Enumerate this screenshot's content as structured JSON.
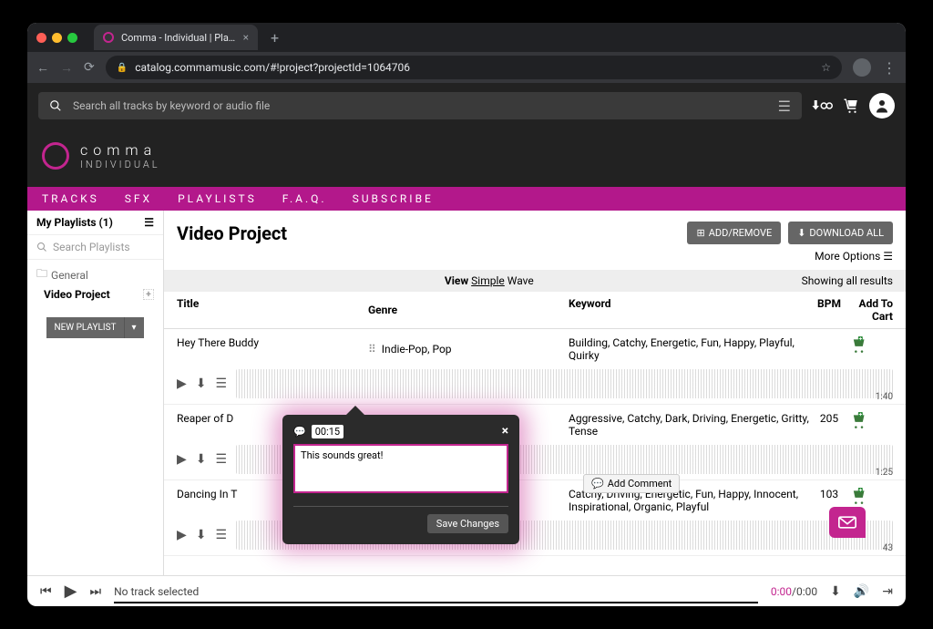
{
  "browser": {
    "tab_title": "Comma - Individual | Playlist D",
    "url": "catalog.commamusic.com/#!project?projectId=1064706"
  },
  "app_header": {
    "search_placeholder": "Search all tracks by keyword or audio file",
    "brand_line1": "comma",
    "brand_line2": "INDIVIDUAL"
  },
  "nav": {
    "items": [
      "TRACKS",
      "SFX",
      "PLAYLISTS",
      "F.A.Q.",
      "SUBSCRIBE"
    ]
  },
  "sidebar": {
    "title": "My Playlists (1)",
    "search_placeholder": "Search Playlists",
    "folder_label": "General",
    "playlist_item": "Video Project",
    "new_button": "NEW PLAYLIST"
  },
  "project": {
    "title": "Video Project",
    "add_remove": "ADD/REMOVE",
    "download_all": "DOWNLOAD ALL",
    "more_options": "More Options",
    "view_label": "View",
    "view_simple": "Simple",
    "view_wave": "Wave",
    "showing": "Showing all results"
  },
  "columns": {
    "title": "Title",
    "genre": "Genre",
    "keyword": "Keyword",
    "bpm": "BPM",
    "cart": "Add To Cart"
  },
  "tracks": [
    {
      "title": "Hey There Buddy",
      "genre": "Indie-Pop, Pop",
      "keyword": "Building, Catchy, Energetic, Fun, Happy, Playful, Quirky",
      "bpm": "",
      "duration": "1:40"
    },
    {
      "title": "Reaper of D",
      "genre": "",
      "keyword": "Aggressive, Catchy, Dark, Driving, Energetic, Gritty, Tense",
      "bpm": "205",
      "duration": "1:25"
    },
    {
      "title": "Dancing In T",
      "genre": "",
      "keyword": "Catchy, Driving, Energetic, Fun, Happy, Innocent, Inspirational, Organic, Playful",
      "bpm": "103",
      "duration": "43"
    }
  ],
  "popover": {
    "timestamp": "00:15",
    "text": "This sounds great!",
    "save": "Save Changes"
  },
  "add_comment_label": "Add Comment",
  "player": {
    "status": "No track selected",
    "current_time": "0:00",
    "total_time": "0:00"
  }
}
